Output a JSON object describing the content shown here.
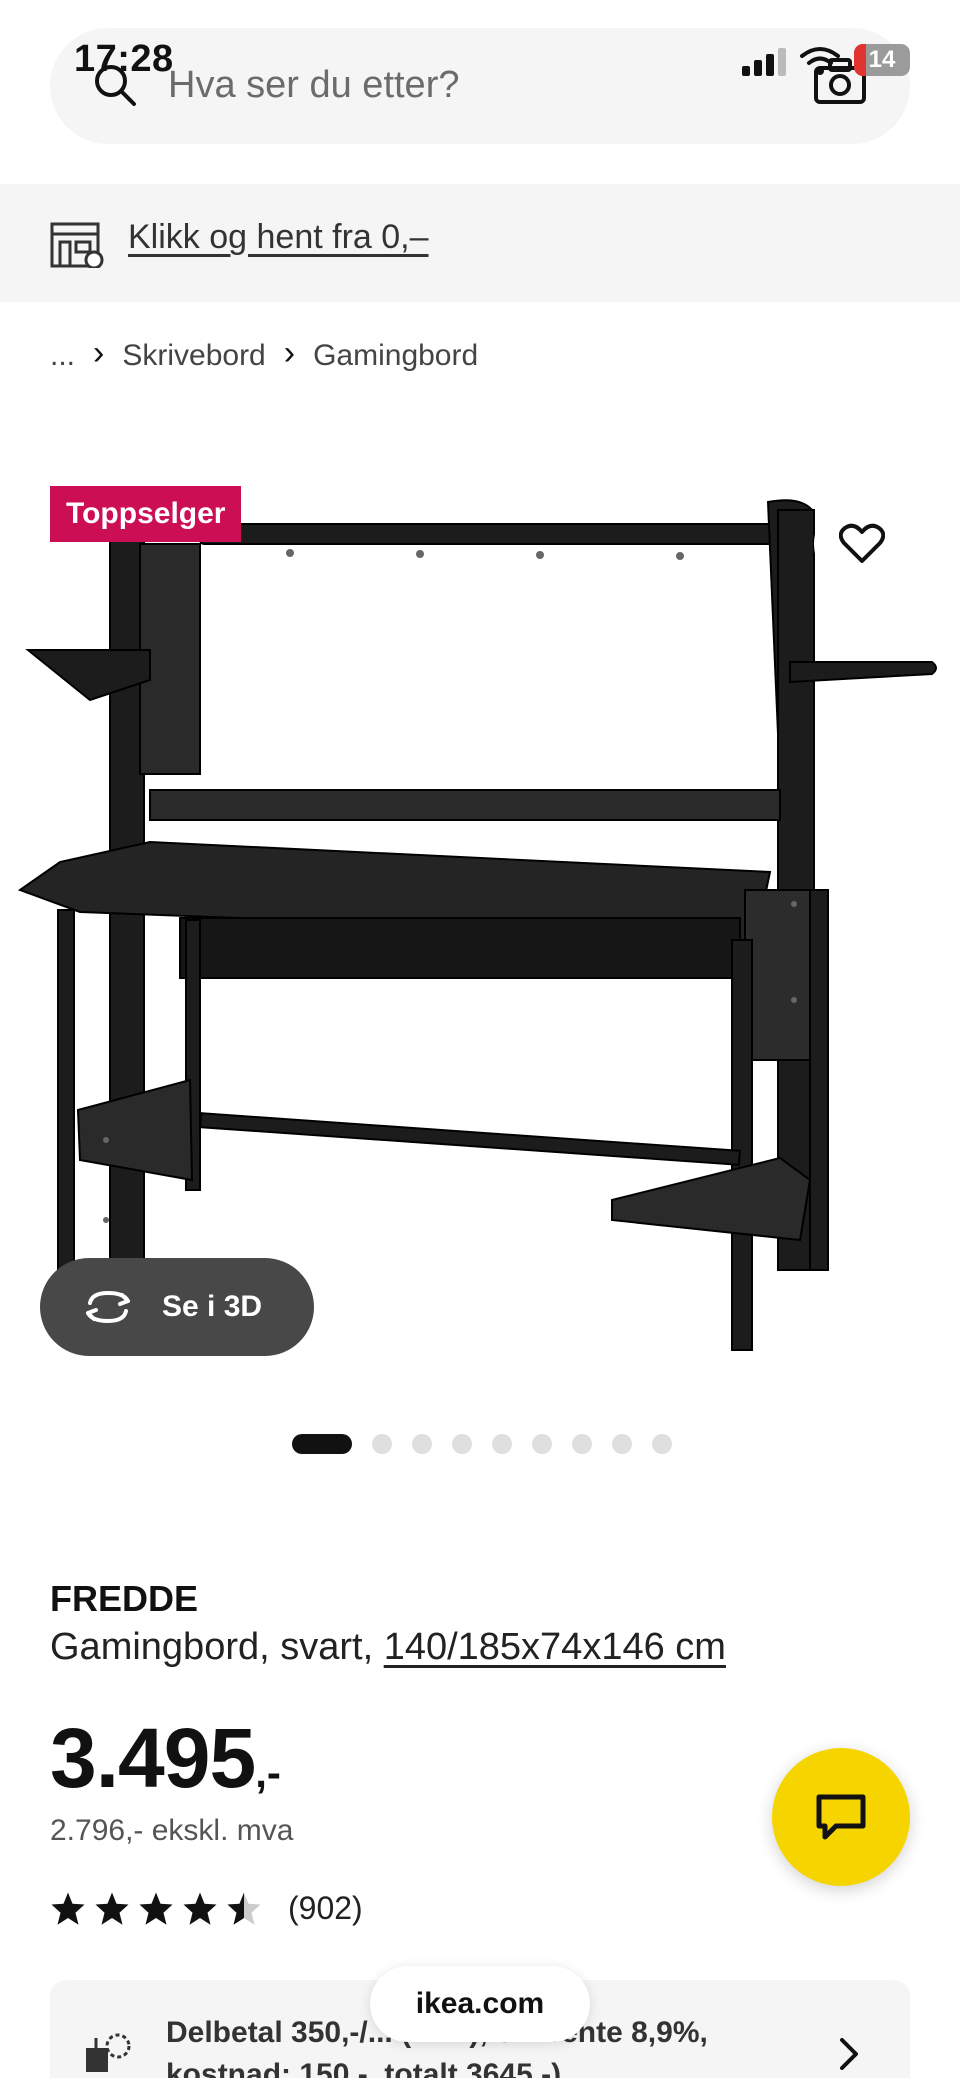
{
  "status_bar": {
    "time": "17:28",
    "battery": "14"
  },
  "search": {
    "placeholder": "Hva ser du etter?"
  },
  "pickup": {
    "label": "Klikk og hent fra 0,–"
  },
  "breadcrumb": {
    "ellipsis": "...",
    "items": [
      "Skrivebord",
      "Gamingbord"
    ]
  },
  "product_image": {
    "badge": "Toppselger",
    "view_3d_label": "Se i 3D",
    "slide_count": 9,
    "active_slide": 1
  },
  "product": {
    "name": "FREDDE",
    "description": "Gamingbord, svart, ",
    "dimensions": "140/185x74x146 cm",
    "price_main": "3.495",
    "price_suffix": ",-",
    "price_ex_vat": "2.796,- ekskl. mva",
    "rating_value": 4.5,
    "rating_count": "(902)"
  },
  "installment": {
    "text": "Delbetal 350,-/... (... ...), eff. rente 8,9%, kostnad: 150,-, totalt 3645,-)"
  },
  "browser": {
    "url": "ikea.com"
  },
  "colors": {
    "accent_badge": "#cc0e54",
    "chat_fab": "#f5d400",
    "btn_3d": "#484848"
  }
}
